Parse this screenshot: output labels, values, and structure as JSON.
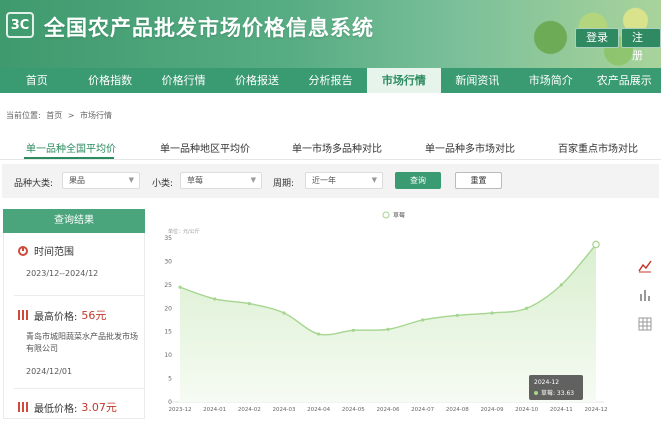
{
  "header": {
    "logo_text": "3C",
    "title": "全国农产品批发市场价格信息系统",
    "login_label": "登录",
    "register_label": "注册"
  },
  "nav": [
    "首页",
    "价格指数",
    "价格行情",
    "价格报送",
    "分析报告",
    "市场行情",
    "新闻资讯",
    "市场简介",
    "农产品展示"
  ],
  "nav_active_index": 5,
  "breadcrumb": {
    "prefix": "当前位置:",
    "home": "首页",
    "separator": ">",
    "current": "市场行情"
  },
  "subtabs": [
    "单一品种全国平均价",
    "单一品种地区平均价",
    "单一市场多品种对比",
    "单一品种多市场对比",
    "百家重点市场对比"
  ],
  "filters": {
    "category_label": "品种大类:",
    "category_value": "果品",
    "subcategory_label": "小类:",
    "subcategory_value": "草莓",
    "period_label": "周期:",
    "period_value": "近一年",
    "query_label": "查询",
    "reset_label": "重置"
  },
  "results": {
    "header": "查询结果",
    "time_range_title": "时间范围",
    "time_range_value": "2023/12--2024/12",
    "max_price_title": "最高价格:",
    "max_price_value": "56元",
    "max_market": "青岛市城阳蔬菜水产品批发市场有限公司",
    "max_date": "2024/12/01",
    "min_price_title": "最低价格:",
    "min_price_value": "3.07元"
  },
  "chart_data": {
    "type": "area",
    "legend": [
      "草莓"
    ],
    "legend_position": "top-center",
    "ylabel": "单位：元/公斤",
    "ylim": [
      0,
      35
    ],
    "yticks": [
      0,
      5,
      10,
      15,
      20,
      25,
      30,
      35
    ],
    "x": [
      "2023-12",
      "2024-01",
      "2024-02",
      "2024-03",
      "2024-04",
      "2024-05",
      "2024-06",
      "2024-07",
      "2024-08",
      "2024-09",
      "2024-10",
      "2024-11",
      "2024-12"
    ],
    "series": [
      {
        "name": "草莓",
        "values": [
          24.5,
          22.0,
          21.0,
          19.0,
          14.5,
          15.3,
          15.5,
          17.5,
          18.5,
          19.0,
          20.0,
          25.0,
          33.63
        ]
      }
    ],
    "grid": false,
    "tooltip": {
      "title": "2024-12",
      "label": "草莓",
      "value": "33.63"
    },
    "colors": {
      "line": "#a5d58f",
      "fill_top": "#d9efcf",
      "fill_bottom": "#f6fbf3"
    }
  },
  "side_icons": [
    "line-chart-icon",
    "bar-chart-icon",
    "table-icon"
  ],
  "colors": {
    "primary": "#3a9a72",
    "active_text": "#2b8a5e",
    "price_red": "#c0392b"
  }
}
